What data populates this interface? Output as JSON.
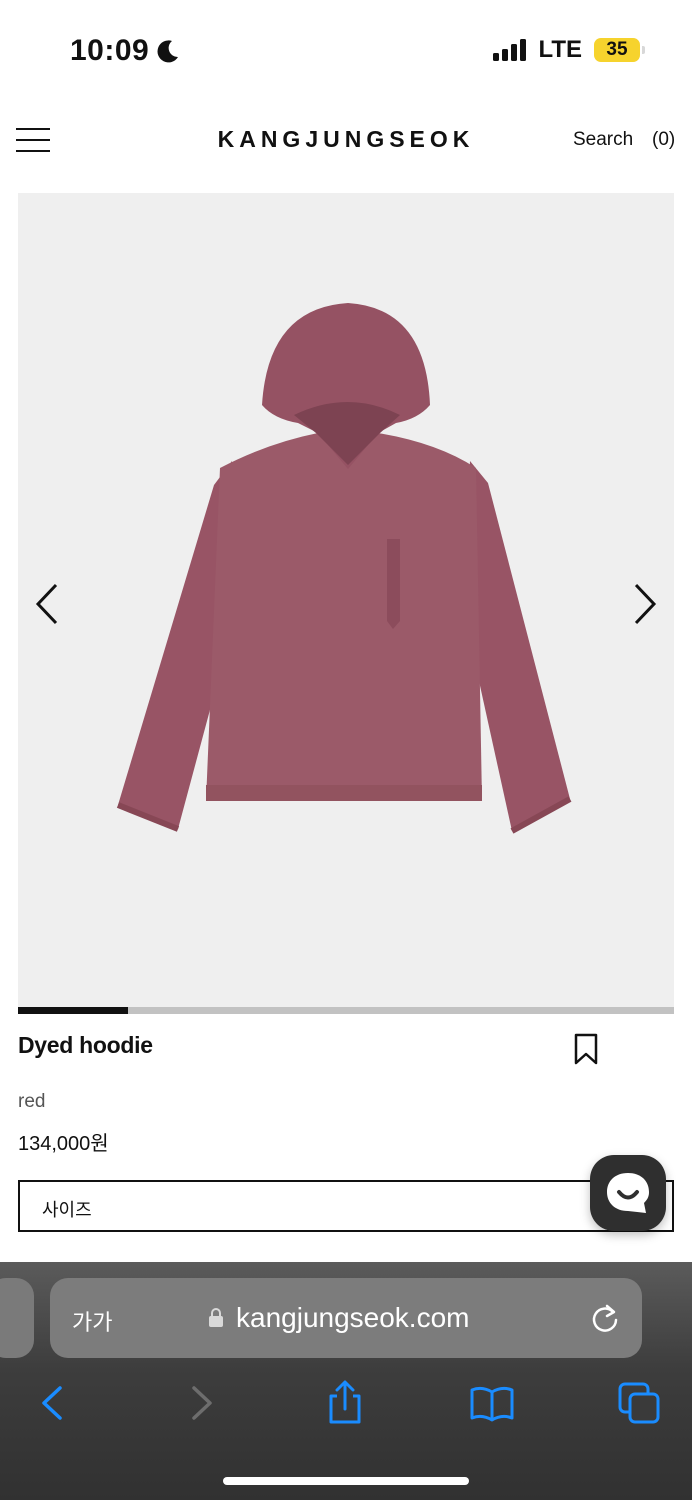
{
  "status_bar": {
    "time": "10:09",
    "network": "LTE",
    "battery": "35",
    "icons": [
      "moon-icon",
      "signal-icon",
      "battery-icon"
    ]
  },
  "header": {
    "logo": "KANGJUNGSEOK",
    "search_label": "Search",
    "cart_label": "(0)",
    "icons": [
      "hamburger-menu-icon"
    ]
  },
  "gallery": {
    "current_slide_fraction": 0.167,
    "icons": [
      "chevron-left-icon",
      "chevron-right-icon"
    ],
    "image_subject": "product-photo"
  },
  "product": {
    "name": "Dyed hoodie",
    "color": "red",
    "price": "134,000원",
    "size_placeholder": "사이즈",
    "icons": [
      "bookmark-icon"
    ]
  },
  "chat": {
    "icon": "chat-smile-icon"
  },
  "safari": {
    "text_size_label": "가가",
    "url": "kangjungseok.com",
    "icons": [
      "lock-icon",
      "reload-icon",
      "back-icon",
      "forward-icon",
      "share-icon",
      "bookmarks-icon",
      "tabs-icon"
    ]
  },
  "colors": {
    "accent_blue": "#1a8cff",
    "hoodie": "#9b5a69",
    "battery_yellow": "#f6d32d"
  }
}
